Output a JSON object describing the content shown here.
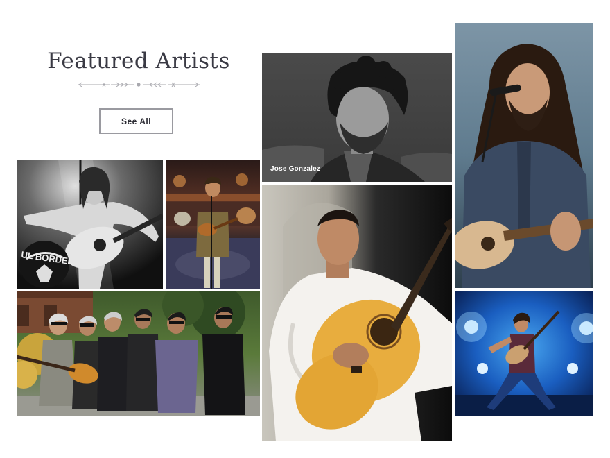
{
  "section": {
    "title": "Featured Artists",
    "see_all_label": "See All"
  },
  "artists": {
    "jose": {
      "name": "Jose Gonzalez"
    },
    "rock_photo_banner": "UL BORDEL"
  },
  "colors": {
    "heading": "#3a3a44",
    "button_border": "#9a9aa0",
    "ornament": "#a8a8ae"
  }
}
